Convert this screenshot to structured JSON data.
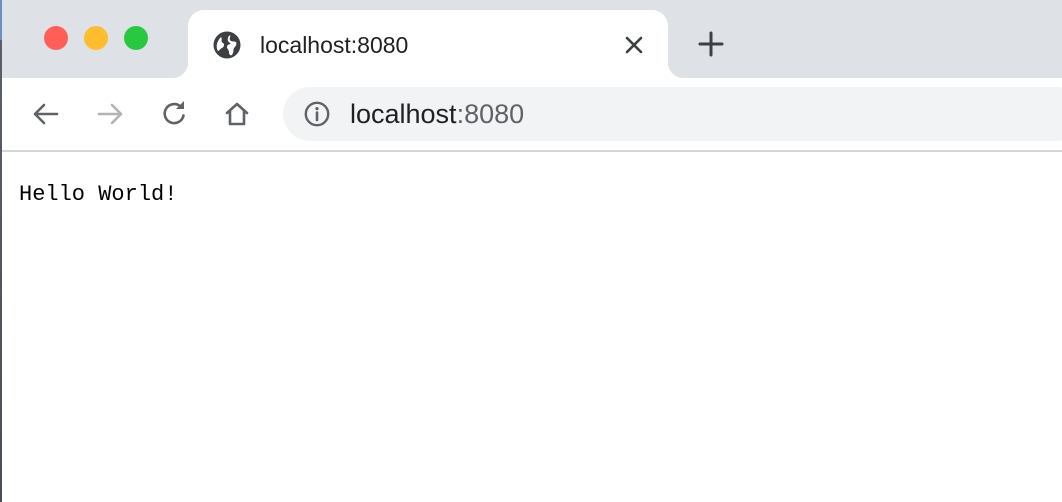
{
  "tab": {
    "title": "localhost:8080",
    "favicon": "globe-icon",
    "close_icon": "close-icon"
  },
  "new_tab": {
    "icon": "plus-icon"
  },
  "window_controls": {
    "close_color": "#ff5f57",
    "minimize_color": "#febc2e",
    "zoom_color": "#28c840"
  },
  "toolbar": {
    "back_icon": "arrow-left-icon",
    "forward_icon": "arrow-right-icon",
    "reload_icon": "reload-icon",
    "home_icon": "home-icon"
  },
  "omnibox": {
    "info_icon": "info-icon",
    "url_host": "localhost",
    "url_port": ":8080"
  },
  "page": {
    "body_text": "Hello World!"
  }
}
